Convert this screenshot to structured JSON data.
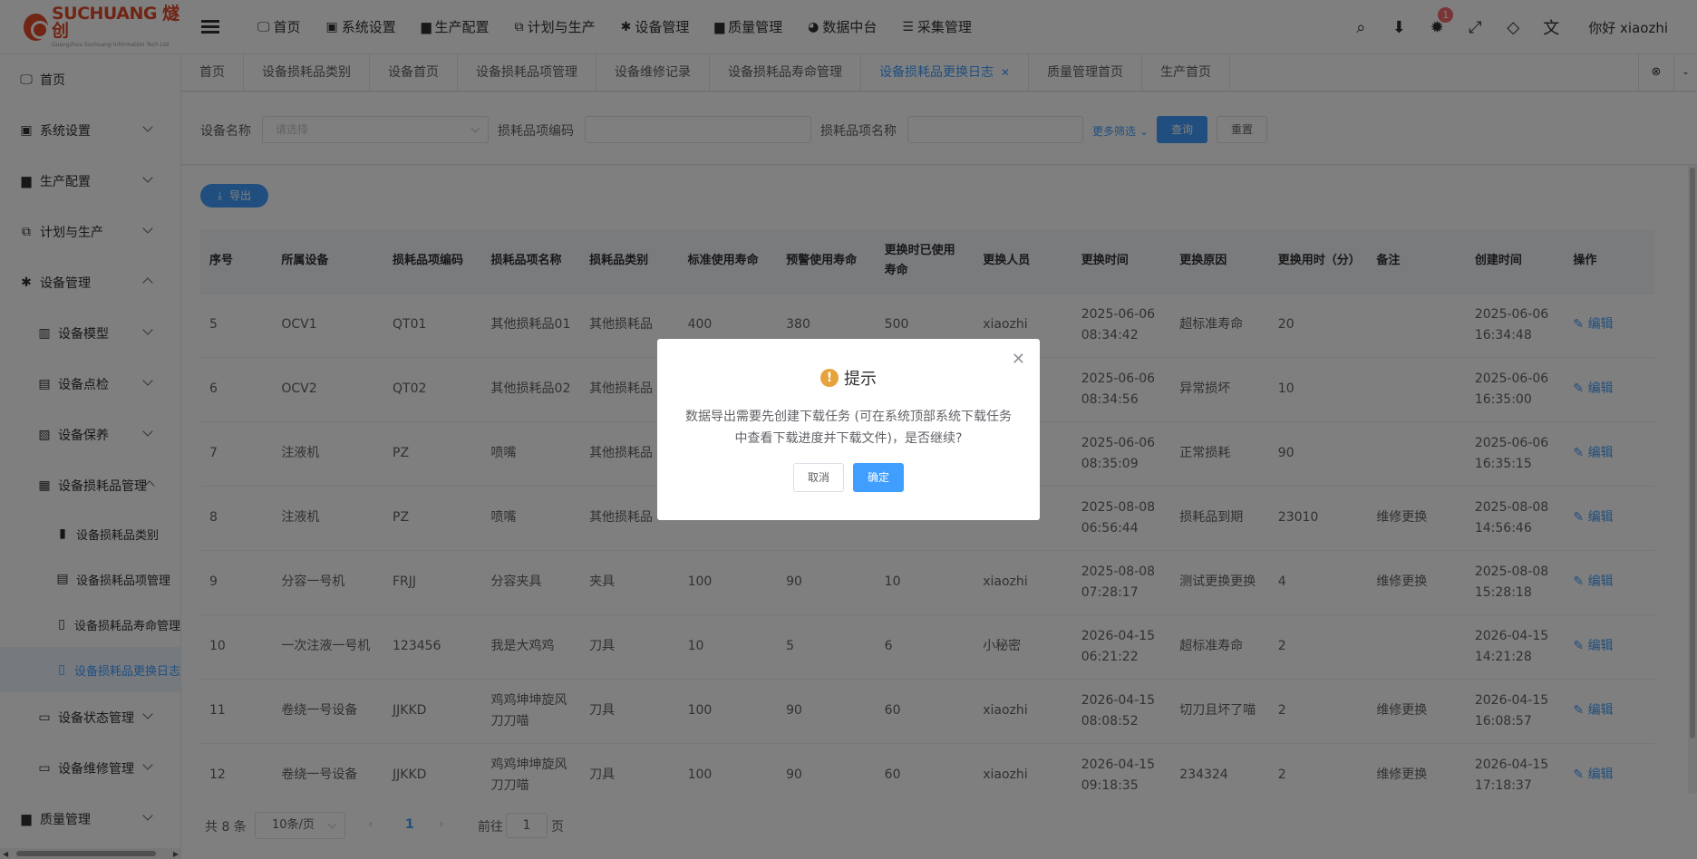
{
  "brand": {
    "logo_text": "SUCHUANG 燧创",
    "logo_sub": "Guangzhou Suchuang Information Tech Ltd"
  },
  "top_nav": [
    {
      "label": "首页",
      "icon": "monitor-icon"
    },
    {
      "label": "系统设置",
      "icon": "user-icon"
    },
    {
      "label": "生产配置",
      "icon": "briefcase-icon"
    },
    {
      "label": "计划与生产",
      "icon": "network-icon"
    },
    {
      "label": "设备管理",
      "icon": "gear-icon"
    },
    {
      "label": "质量管理",
      "icon": "briefcase-icon"
    },
    {
      "label": "数据中台",
      "icon": "pie-icon"
    },
    {
      "label": "采集管理",
      "icon": "database-icon"
    }
  ],
  "header_right": {
    "notification_count": "1",
    "greeting": "你好 xiaozhi"
  },
  "sidebar": {
    "items": [
      {
        "label": "首页"
      },
      {
        "label": "系统设置"
      },
      {
        "label": "生产配置"
      },
      {
        "label": "计划与生产"
      },
      {
        "label": "设备管理"
      },
      {
        "label": "设备模型"
      },
      {
        "label": "设备点检"
      },
      {
        "label": "设备保养"
      },
      {
        "label": "设备损耗品管理"
      },
      {
        "label": "设备损耗品类别"
      },
      {
        "label": "设备损耗品项管理"
      },
      {
        "label": "设备损耗品寿命管理"
      },
      {
        "label": "设备损耗品更换日志"
      },
      {
        "label": "设备状态管理"
      },
      {
        "label": "设备维修管理"
      },
      {
        "label": "质量管理"
      }
    ]
  },
  "tabs": [
    {
      "label": "首页"
    },
    {
      "label": "设备损耗品类别"
    },
    {
      "label": "设备首页"
    },
    {
      "label": "设备损耗品项管理"
    },
    {
      "label": "设备维修记录"
    },
    {
      "label": "设备损耗品寿命管理"
    },
    {
      "label": "设备损耗品更换日志"
    },
    {
      "label": "质量管理首页"
    },
    {
      "label": "生产首页"
    }
  ],
  "search": {
    "device_label": "设备名称",
    "device_placeholder": "请选择",
    "code_label": "损耗品项编码",
    "name_label": "损耗品项名称",
    "more_label": "更多筛选",
    "query_label": "查询",
    "reset_label": "重置"
  },
  "toolbar": {
    "export_label": "导出"
  },
  "table": {
    "headers": [
      "序号",
      "所属设备",
      "损耗品项编码",
      "损耗品项名称",
      "损耗品类别",
      "标准使用寿命",
      "预警使用寿命",
      "更换时已使用寿命",
      "更换人员",
      "更换时间",
      "更换原因",
      "更换用时（分）",
      "备注",
      "创建时间",
      "操作"
    ],
    "edit_label": "编辑",
    "rows": [
      [
        "5",
        "OCV1",
        "QT01",
        "其他损耗品01",
        "其他损耗品",
        "400",
        "380",
        "500",
        "xiaozhi",
        "2025-06-06 08:34:42",
        "超标准寿命",
        "20",
        "",
        "2025-06-06 16:34:48"
      ],
      [
        "6",
        "OCV2",
        "QT02",
        "其他损耗品02",
        "其他损耗品",
        "",
        "",
        "",
        "",
        "2025-06-06 08:34:56",
        "异常损坏",
        "10",
        "",
        "2025-06-06 16:35:00"
      ],
      [
        "7",
        "注液机",
        "PZ",
        "喷嘴",
        "其他损耗品",
        "",
        "",
        "",
        "",
        "2025-06-06 08:35:09",
        "正常损耗",
        "90",
        "",
        "2025-06-06 16:35:15"
      ],
      [
        "8",
        "注液机",
        "PZ",
        "喷嘴",
        "其他损耗品",
        "",
        "",
        "",
        "",
        "2025-08-08 06:56:44",
        "损耗品到期",
        "23010",
        "维修更换",
        "2025-08-08 14:56:46"
      ],
      [
        "9",
        "分容一号机",
        "FRJJ",
        "分容夹具",
        "夹具",
        "100",
        "90",
        "10",
        "xiaozhi",
        "2025-08-08 07:28:17",
        "测试更换更换",
        "4",
        "维修更换",
        "2025-08-08 15:28:18"
      ],
      [
        "10",
        "一次注液一号机",
        "123456",
        "我是大鸡鸡",
        "刀具",
        "10",
        "5",
        "6",
        "小秘密",
        "2026-04-15 06:21:22",
        "超标准寿命",
        "2",
        "",
        "2026-04-15 14:21:28"
      ],
      [
        "11",
        "卷绕一号设备",
        "JJKKD",
        "鸡鸡坤坤旋风刀刀喵",
        "刀具",
        "100",
        "90",
        "60",
        "xiaozhi",
        "2026-04-15 08:08:52",
        "切刀且坏了喵",
        "2",
        "维修更换",
        "2026-04-15 16:08:57"
      ],
      [
        "12",
        "卷绕一号设备",
        "JJKKD",
        "鸡鸡坤坤旋风刀刀喵",
        "刀具",
        "100",
        "90",
        "60",
        "xiaozhi",
        "2026-04-15 09:18:35",
        "234324",
        "2",
        "维修更换",
        "2026-04-15 17:18:37"
      ]
    ]
  },
  "pager": {
    "total": "共 8 条",
    "page_size": "10条/页",
    "current": "1",
    "goto_prefix": "前往",
    "goto_value": "1",
    "goto_suffix": "页"
  },
  "dialog": {
    "title": "提示",
    "message": "数据导出需要先创建下载任务 (可在系统顶部系统下载任务中查看下载进度并下载文件)，是否继续?",
    "cancel_label": "取消",
    "confirm_label": "确定"
  },
  "colors": {
    "primary": "#409eff",
    "warning": "#e6a23c",
    "danger": "#f56c6c",
    "brand": "#e04a2a"
  }
}
